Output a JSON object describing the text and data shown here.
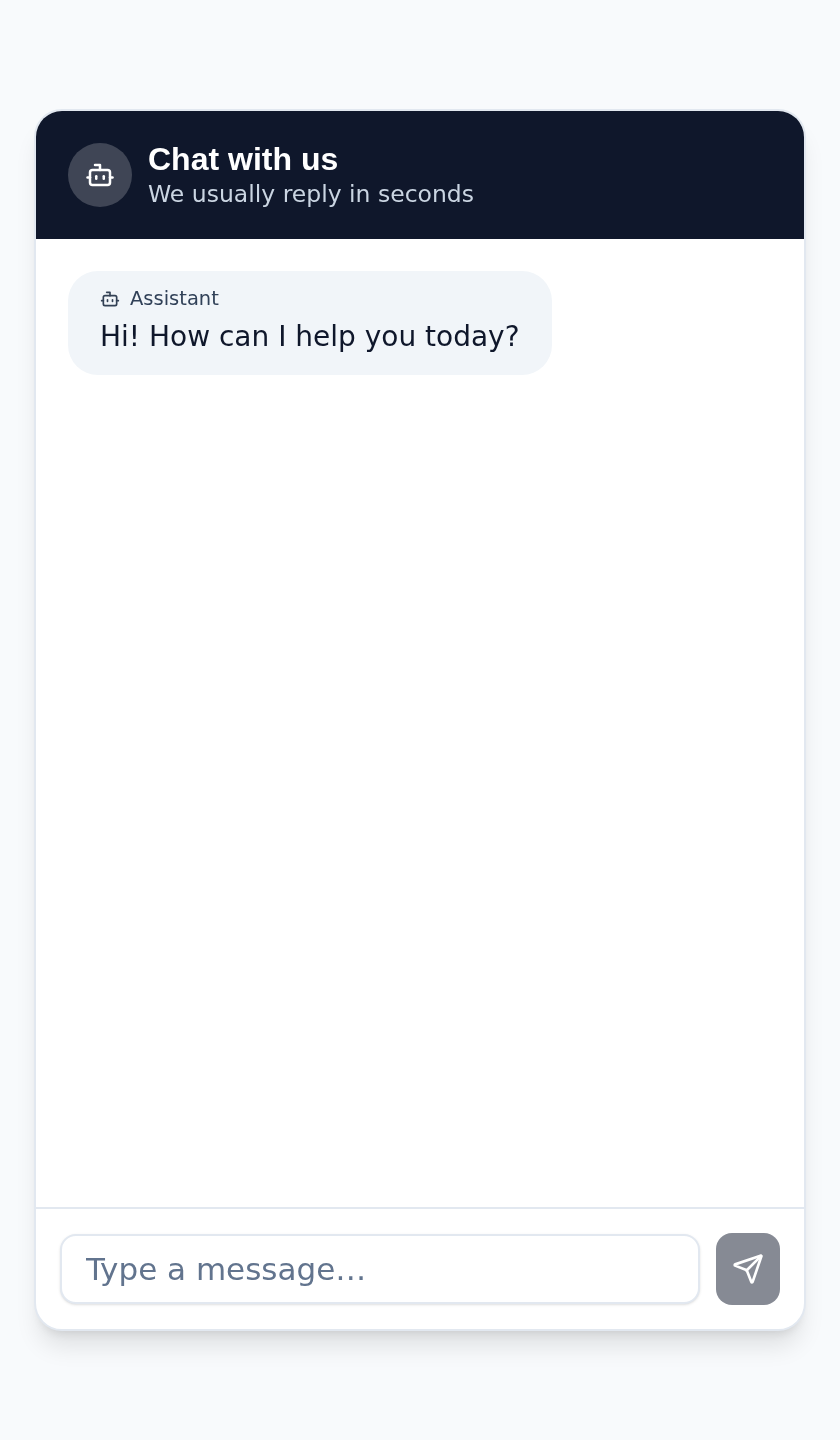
{
  "header": {
    "title": "Chat with us",
    "subtitle": "We usually reply in seconds"
  },
  "messages": [
    {
      "kind": "assistant",
      "sender": "Assistant",
      "text": "Hi! How can I help you today?"
    }
  ],
  "composer": {
    "placeholder": "Type a message…",
    "send_disabled": true
  }
}
